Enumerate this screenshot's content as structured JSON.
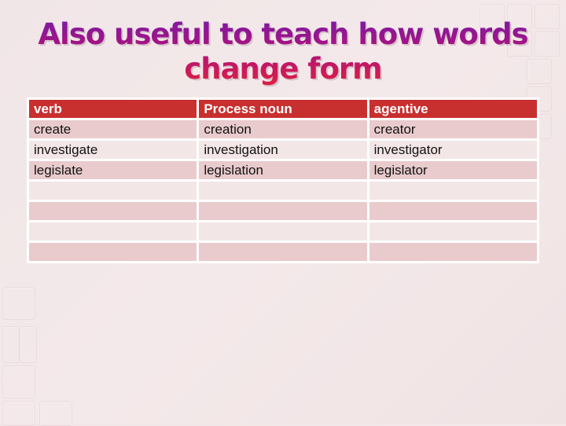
{
  "slide": {
    "title": "Also useful to teach how words change form",
    "title_lines": [
      "Also useful to teach how words",
      "change form"
    ],
    "colors": {
      "header_bg": "#c8302f",
      "row_odd_bg": "#e9cbcd",
      "row_even_bg": "#f3e6e7",
      "title_gradient_top": "#7a1aa6",
      "title_gradient_bottom": "#e0203f"
    }
  },
  "table": {
    "headers": [
      "verb",
      "Process noun",
      "agentive"
    ],
    "rows": [
      [
        "create",
        "creation",
        "creator"
      ],
      [
        "investigate",
        "investigation",
        "investigator"
      ],
      [
        "legislate",
        "legislation",
        "legislator"
      ],
      [
        "",
        "",
        ""
      ],
      [
        "",
        "",
        ""
      ],
      [
        "",
        "",
        ""
      ],
      [
        "",
        "",
        ""
      ]
    ]
  }
}
